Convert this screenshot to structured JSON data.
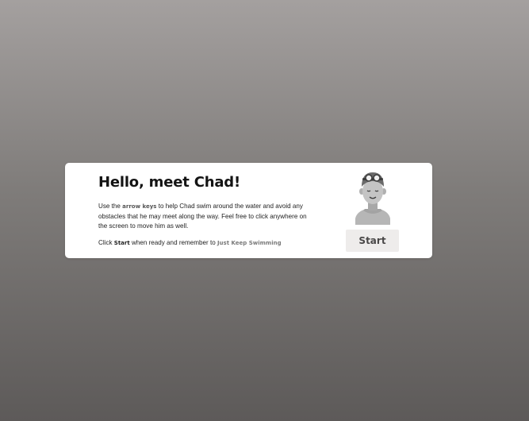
{
  "intro": {
    "title": "Hello, meet Chad!",
    "description_before_keys": "Use the ",
    "keys_label": "arrow keys",
    "description_after_keys": " to help Chad swim around the water and avoid any obstacles that he may meet along the way. Feel free to click anywhere on the screen to move him as well.",
    "ready_before": "Click ",
    "ready_start_word": "Start",
    "ready_middle": " when ready and remember to ",
    "ready_motto": "Just Keep Swimming",
    "start_button": "Start"
  },
  "avatar": {
    "icon": "swimmer-avatar-icon"
  },
  "colors": {
    "background_top": "#a4a09f",
    "background_bottom": "#5d5a59",
    "card": "#ffffff",
    "button_bg": "#eeeceb",
    "button_text": "#4a4848"
  }
}
